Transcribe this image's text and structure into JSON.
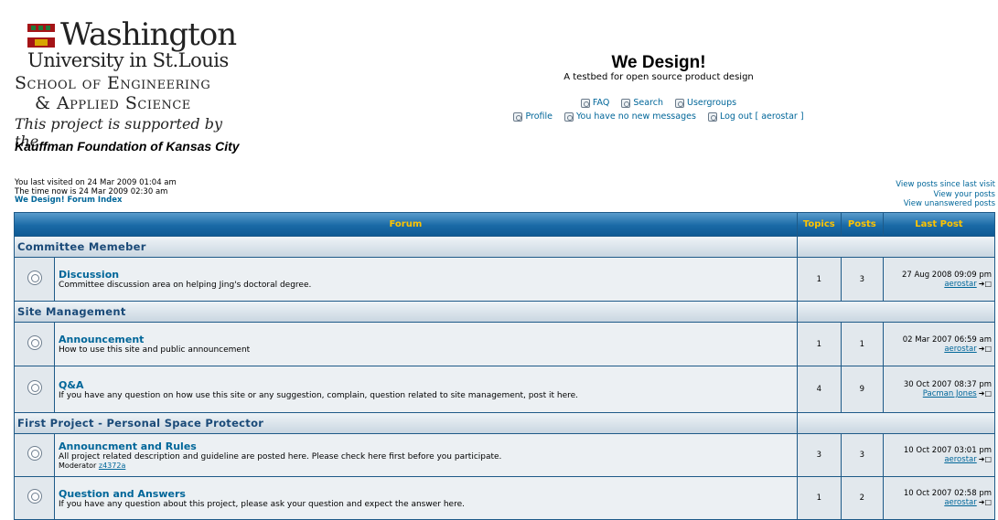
{
  "logo": {
    "line1": "Washington",
    "line2": "University in St.Louis",
    "line3": "School of Engineering",
    "line4": "& Applied Science",
    "line5": "This project is supported by the",
    "line6": "Kauffman Foundation of Kansas City"
  },
  "header": {
    "title": "We Design!",
    "description": "A testbed for open source product design",
    "nav1": [
      {
        "label": "FAQ",
        "icon": "faq-icon"
      },
      {
        "label": "Search",
        "icon": "search-icon"
      },
      {
        "label": "Usergroups",
        "icon": "usergroups-icon"
      }
    ],
    "nav2": [
      {
        "label": "Profile",
        "icon": "profile-icon"
      },
      {
        "label": "You have no new messages",
        "icon": "messages-icon"
      },
      {
        "label": "Log out [ aerostar ]",
        "icon": "logout-icon"
      }
    ]
  },
  "info": {
    "last_visit": "You last visited on 24 Mar 2009 01:04 am",
    "time_now": "The time now is 24 Mar 2009 02:30 am",
    "index_link": "We Design! Forum Index",
    "links": [
      "View posts since last visit",
      "View your posts",
      "View unanswered posts"
    ]
  },
  "table": {
    "headers": [
      "Forum",
      "Topics",
      "Posts",
      "Last Post"
    ]
  },
  "categories": [
    {
      "name": "Committee Memeber",
      "forums": [
        {
          "name": "Discussion",
          "desc": "Committee discussion area on helping Jing's doctoral degree.",
          "topics": "1",
          "posts": "3",
          "last_date": "27 Aug 2008 09:09 pm",
          "last_author": "aerostar"
        }
      ]
    },
    {
      "name": "Site Management",
      "forums": [
        {
          "name": "Announcement",
          "desc": "How to use this site and public announcement",
          "topics": "1",
          "posts": "1",
          "last_date": "02 Mar 2007 06:59 am",
          "last_author": "aerostar"
        },
        {
          "name": "Q&A",
          "desc": "If you have any question on how use this site or any suggestion, complain, question related to site management, post it here.",
          "topics": "4",
          "posts": "9",
          "last_date": "30 Oct 2007 08:37 pm",
          "last_author": "Pacman Jones"
        }
      ]
    },
    {
      "name": "First Project - Personal Space Protector",
      "forums": [
        {
          "name": "Announcment and Rules",
          "desc": "All project related description and guideline are posted here. Please check here first before you participate.",
          "moderator_label": "Moderator",
          "moderator": "z4372a",
          "topics": "3",
          "posts": "3",
          "last_date": "10 Oct 2007 03:01 pm",
          "last_author": "aerostar"
        },
        {
          "name": "Question and Answers",
          "desc": "If you have any question about this project, please ask your question and expect the answer here.",
          "topics": "1",
          "posts": "2",
          "last_date": "10 Oct 2007 02:58 pm",
          "last_author": "aerostar"
        }
      ]
    }
  ],
  "goto_symbol": "➜□"
}
